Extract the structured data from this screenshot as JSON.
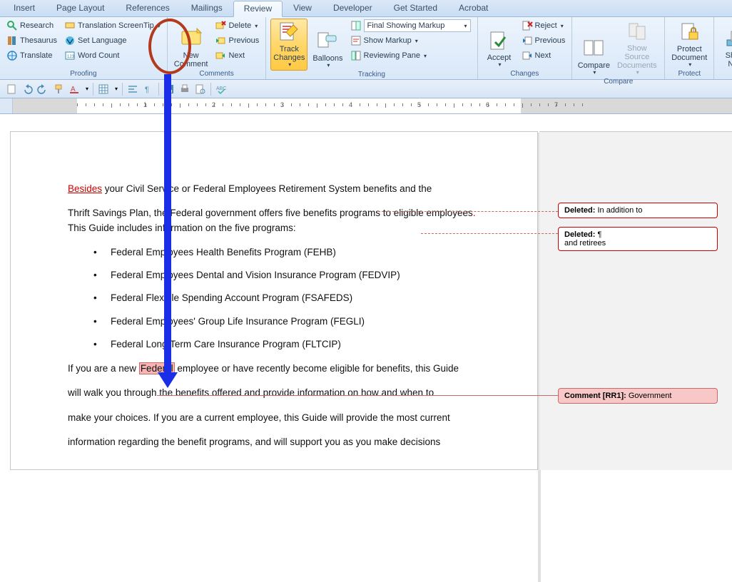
{
  "tabs": [
    "Insert",
    "Page Layout",
    "References",
    "Mailings",
    "Review",
    "View",
    "Developer",
    "Get Started",
    "Acrobat"
  ],
  "active_tab": "Review",
  "ribbon": {
    "proofing": {
      "label": "Proofing",
      "research": "Research",
      "thesaurus": "Thesaurus",
      "translate": "Translate",
      "screentip": "Translation ScreenTip",
      "set_lang": "Set Language",
      "word_count": "Word Count"
    },
    "comments": {
      "label": "Comments",
      "new_comment": "New\nComment",
      "delete": "Delete",
      "previous": "Previous",
      "next": "Next"
    },
    "tracking": {
      "label": "Tracking",
      "track_changes": "Track\nChanges",
      "balloons": "Balloons",
      "display_mode": "Final Showing Markup",
      "show_markup": "Show Markup",
      "reviewing_pane": "Reviewing Pane"
    },
    "changes": {
      "label": "Changes",
      "accept": "Accept",
      "reject": "Reject",
      "previous": "Previous",
      "next": "Next"
    },
    "compare": {
      "label": "Compare",
      "compare": "Compare",
      "show_source": "Show Source\nDocuments"
    },
    "protect": {
      "label": "Protect",
      "protect": "Protect\nDocument"
    },
    "share": {
      "label": "",
      "share": "Share\nNow"
    }
  },
  "doc": {
    "p1_ins": "Besides",
    "p1_rest": " your Civil Service or Federal Employees Retirement System benefits and the",
    "p2a": "Thrift Savings Plan, the Federal government offers five benefits programs to eligible employees",
    "p2b": " This Guide includes information on the five programs:",
    "bullets": [
      "Federal Employees Health Benefits Program (FEHB)",
      "Federal Employees Dental and Vision Insurance Program (FEDVIP)",
      "Federal Flexible Spending Account Program (FSAFEDS)",
      "Federal Employees' Group Life Insurance Program (FEGLI)",
      "Federal Long Term Care Insurance Program (FLTCIP)"
    ],
    "p3a": "If you are a new ",
    "p3_hi": "Federal",
    "p3b": " employee or have recently become eligible for benefits, this Guide",
    "p4": "will walk you through the benefits offered and provide information on how and when to",
    "p5": "make your choices. If you are a current employee, this Guide will provide the most current",
    "p6": "information regarding the benefit programs, and will support you as you make decisions"
  },
  "balloons": {
    "d1_label": "Deleted:",
    "d1_text": "In addition to",
    "d2_label": "Deleted:",
    "d2_text_a": "¶",
    "d2_text_b": "and retirees",
    "c1_label": "Comment [RR1]:",
    "c1_text": "Government"
  },
  "ruler_numbers": [
    "1",
    "2",
    "3",
    "4",
    "5",
    "6",
    "7"
  ]
}
